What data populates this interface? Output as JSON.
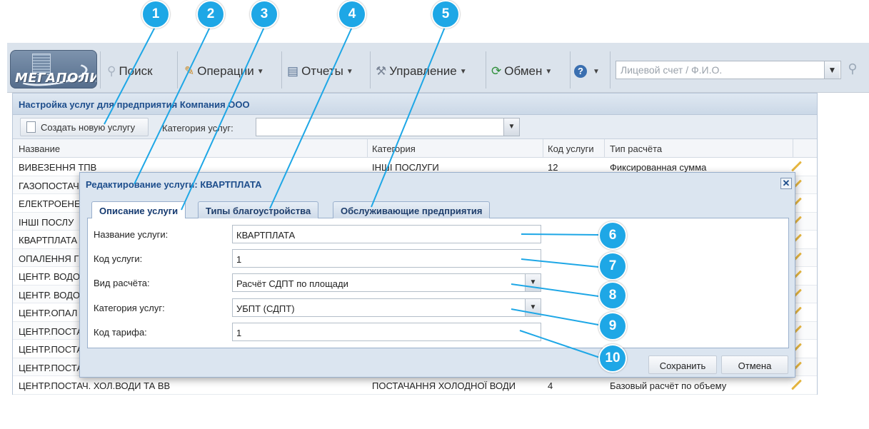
{
  "toolbar": {
    "logo_text": "МЕГАПОЛИС",
    "search_label": "Поиск",
    "operations_label": "Операции",
    "reports_label": "Отчеты",
    "management_label": "Управление",
    "exchange_label": "Обмен",
    "help_icon": "help-icon",
    "account_search_placeholder": "Лицевой счет / Ф.И.О."
  },
  "panel": {
    "title": "Настройка услуг для предприятия Компания ООО",
    "create_button": "Создать новую услугу",
    "category_label": "Категория услуг:",
    "category_value": "",
    "columns": [
      "Название",
      "Категория",
      "Код услуги",
      "Тип расчёта"
    ],
    "rows": [
      {
        "name": "ВИВЕЗЕННЯ ТПВ",
        "category": "ІНШІ ПОСЛУГИ",
        "code": "12",
        "calc": "Фиксированная сумма"
      },
      {
        "name": "ГАЗОПОСТАЧ",
        "category": "",
        "code": "",
        "calc": ""
      },
      {
        "name": "ЕЛЕКТРОЕНЕ",
        "category": "",
        "code": "",
        "calc": ""
      },
      {
        "name": "ІНШІ ПОСЛУ",
        "category": "",
        "code": "",
        "calc": ""
      },
      {
        "name": "КВАРТПЛАТА",
        "category": "",
        "code": "",
        "calc": ""
      },
      {
        "name": "ОПАЛЕННЯ Г",
        "category": "",
        "code": "",
        "calc": ""
      },
      {
        "name": "ЦЕНТР. ВОДО",
        "category": "",
        "code": "",
        "calc": ""
      },
      {
        "name": "ЦЕНТР. ВОДО",
        "category": "",
        "code": "",
        "calc": ""
      },
      {
        "name": "ЦЕНТР.ОПАЛ",
        "category": "",
        "code": "",
        "calc": ""
      },
      {
        "name": "ЦЕНТР.ПОСТА",
        "category": "",
        "code": "",
        "calc": ""
      },
      {
        "name": "ЦЕНТР.ПОСТА",
        "category": "",
        "code": "",
        "calc": ""
      },
      {
        "name": "ЦЕНТР.ПОСТА",
        "category": "",
        "code": "",
        "calc": ""
      },
      {
        "name": "ЦЕНТР.ПОСТАЧ. ХОЛ.ВОДИ ТА ВВ",
        "category": "ПОСТАЧАННЯ ХОЛОДНОЇ ВОДИ",
        "code": "4",
        "calc": "Базовый расчёт по объему"
      }
    ]
  },
  "dialog": {
    "title": "Редактирование услуги: КВАРТПЛАТА",
    "close_symbol": "✕",
    "tabs": [
      "Описание услуги",
      "Типы благоустройства",
      "Обслуживающие предприятия"
    ],
    "fields": {
      "name_label": "Название услуги:",
      "name_value": "КВАРТПЛАТА",
      "code_label": "Код услуги:",
      "code_value": "1",
      "calc_label": "Вид расчёта:",
      "calc_value": "Расчёт СДПТ по площади",
      "category_label": "Категория услуг:",
      "category_value": "УБПТ (СДПТ)",
      "tariff_label": "Код тарифа:",
      "tariff_value": "1"
    },
    "save_button": "Сохранить",
    "cancel_button": "Отмена"
  },
  "callouts": [
    "1",
    "2",
    "3",
    "4",
    "5",
    "6",
    "7",
    "8",
    "9",
    "10"
  ],
  "colors": {
    "callout": "#1ea7e6",
    "panel_title": "#1e4e8c",
    "toolbar_bg": "#dbe3ec"
  }
}
